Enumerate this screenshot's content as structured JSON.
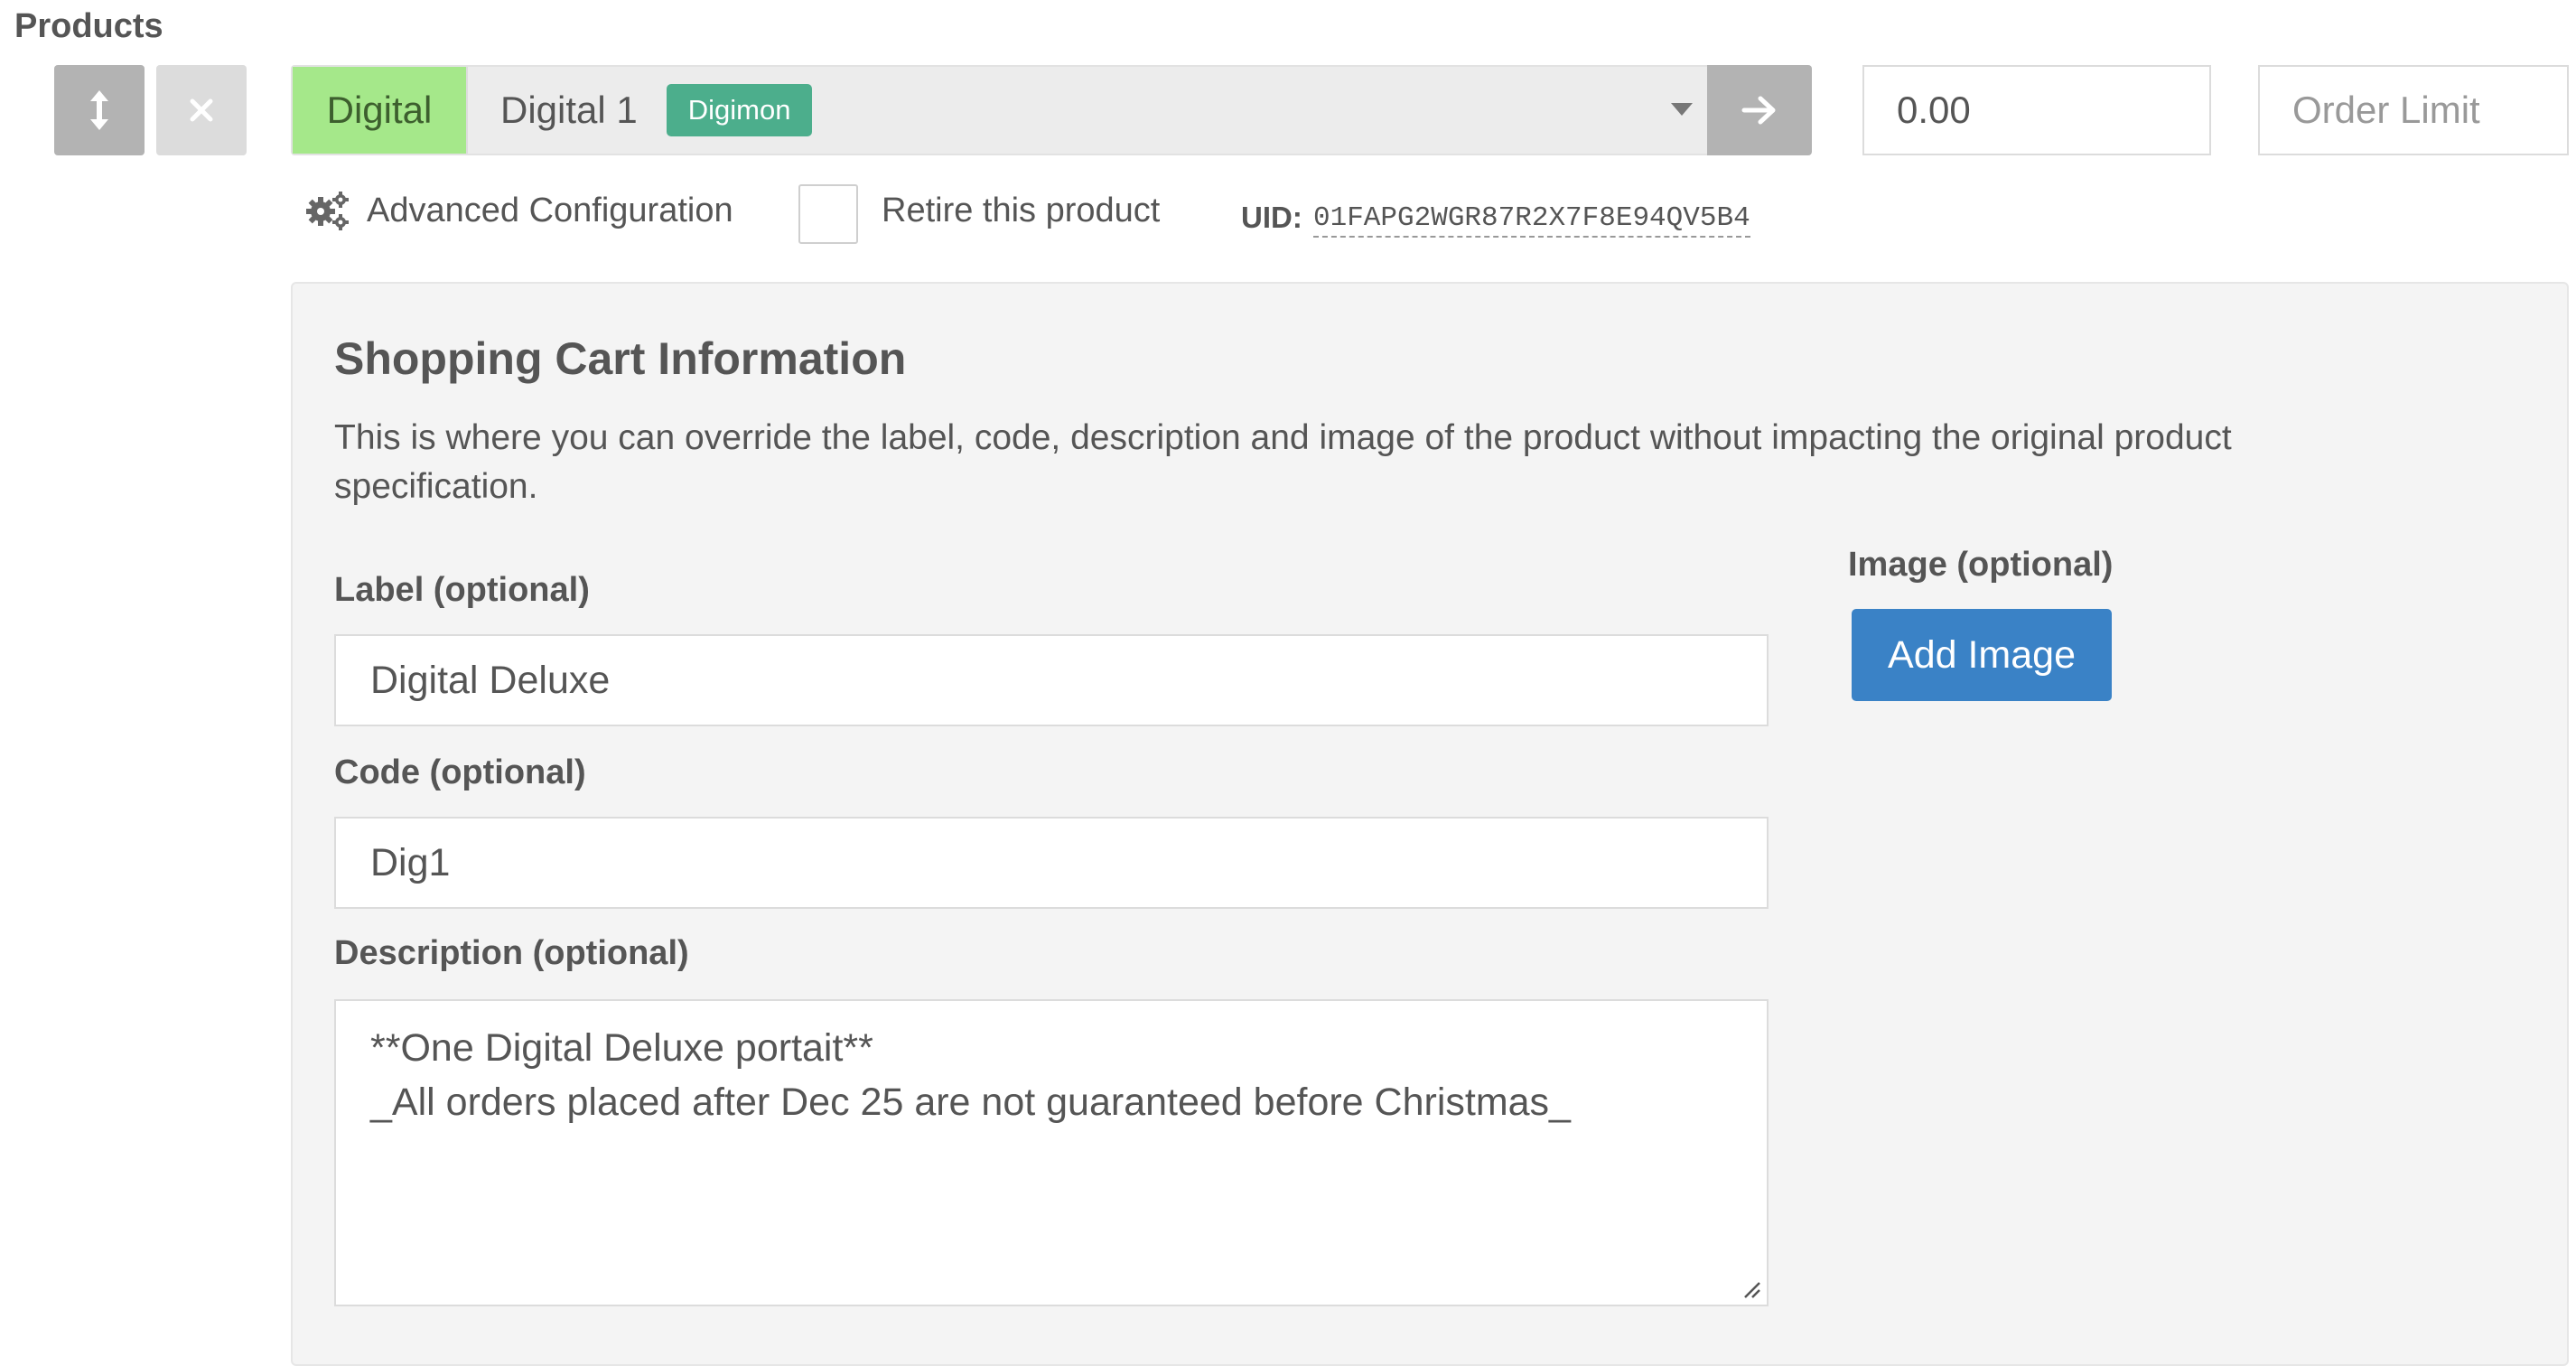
{
  "section": {
    "title": "Products"
  },
  "controls": {
    "move_icon": "vertical-arrows-icon",
    "remove_icon": "close-icon"
  },
  "product": {
    "type_label": "Digital",
    "name": "Digital 1",
    "tag": "Digimon",
    "go_icon": "arrow-right-icon",
    "colors": {
      "type_bg": "#a5e88a",
      "tag_bg": "#4cae8c"
    }
  },
  "price": {
    "value": "0.00"
  },
  "order_limit": {
    "placeholder": "Order Limit"
  },
  "options": {
    "advanced_label": "Advanced Configuration",
    "retire_label": "Retire this product",
    "retire_checked": false,
    "uid_label": "UID:",
    "uid_value": "01FAPG2WGR87R2X7F8E94QV5B4"
  },
  "panel": {
    "title": "Shopping Cart Information",
    "description": "This is where you can override the label, code, description and image of the product without impacting the original product specification.",
    "label_field": {
      "label": "Label (optional)",
      "value": "Digital Deluxe"
    },
    "code_field": {
      "label": "Code (optional)",
      "value": "Dig1"
    },
    "description_field": {
      "label": "Description (optional)",
      "line1": "**One Digital Deluxe portait**",
      "line2": "_All orders placed after Dec 25 are not guaranteed before Christmas_"
    },
    "image_field": {
      "label": "Image (optional)",
      "button": "Add Image"
    },
    "colors": {
      "button_bg": "#3a82c6"
    }
  }
}
